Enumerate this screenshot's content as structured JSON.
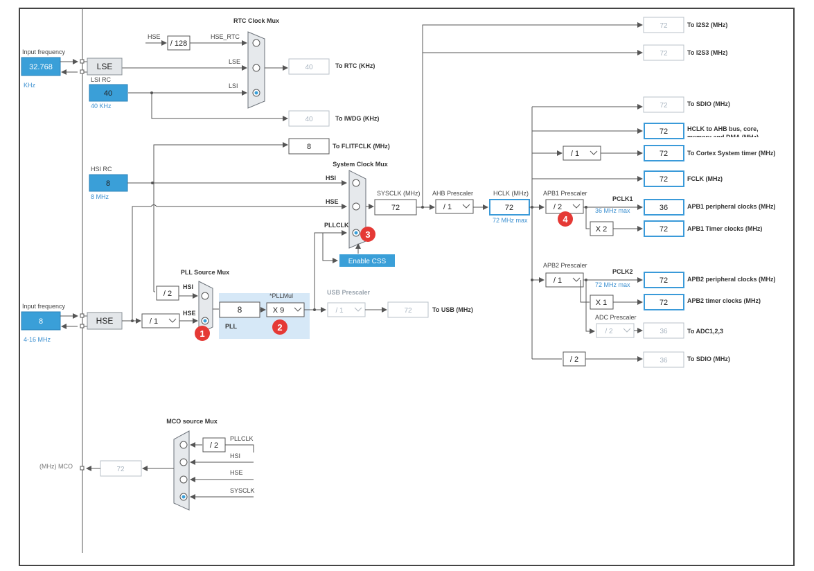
{
  "rtc_mux": {
    "title": "RTC Clock Mux",
    "hse": "HSE",
    "div": "/ 128",
    "hse_rtc": "HSE_RTC",
    "lse": "LSE",
    "lsi": "LSI",
    "out": "40",
    "out_label": "To RTC (KHz)"
  },
  "iwdg": {
    "out": "40",
    "label": "To IWDG (KHz)"
  },
  "flit": {
    "out": "8",
    "label": "To FLITFCLK (MHz)"
  },
  "lse": {
    "input_label": "Input frequency",
    "input": "32.768",
    "unit": "KHz",
    "name": "LSE"
  },
  "lsi": {
    "title": "LSI RC",
    "value": "40",
    "unit": "40 KHz"
  },
  "hsi": {
    "title": "HSI RC",
    "value": "8",
    "unit": "8 MHz"
  },
  "hse": {
    "input_label": "Input frequency",
    "input": "8",
    "unit": "4-16 MHz",
    "name": "HSE",
    "div": "/ 1"
  },
  "pll_source": {
    "title": "PLL Source Mux",
    "div": "/ 2",
    "hsi": "HSI",
    "hse": "HSE"
  },
  "pll": {
    "value": "8",
    "mul_title": "*PLLMul",
    "mul": "X 9",
    "label": "PLL"
  },
  "usb": {
    "title": "USB Prescaler",
    "div": "/ 1",
    "out": "72",
    "label": "To USB (MHz)"
  },
  "sys_mux": {
    "title": "System Clock Mux",
    "hsi": "HSI",
    "hse": "HSE",
    "pllclk": "PLLCLK",
    "css": "Enable CSS"
  },
  "sysclk": {
    "title": "SYSCLK (MHz)",
    "value": "72"
  },
  "ahb": {
    "title": "AHB Prescaler",
    "div": "/ 1"
  },
  "hclk": {
    "title": "HCLK (MHz)",
    "value": "72",
    "max": "72 MHz max"
  },
  "apb1": {
    "title": "APB1 Prescaler",
    "div": "/ 2",
    "pclk": "PCLK1",
    "max": "36 MHz max",
    "timer_mul": "X 2"
  },
  "apb2": {
    "title": "APB2 Prescaler",
    "div": "/ 1",
    "pclk": "PCLK2",
    "max": "72 MHz max",
    "timer_mul": "X 1"
  },
  "adc": {
    "title": "ADC Prescaler",
    "div": "/ 2",
    "out": "36",
    "label": "To ADC1,2,3"
  },
  "cortex": {
    "div": "/ 1"
  },
  "sdio2": {
    "div": "/ 2",
    "out": "36",
    "label": "To SDIO (MHz)"
  },
  "outputs": {
    "i2s2": {
      "value": "72",
      "label": "To I2S2 (MHz)"
    },
    "i2s3": {
      "value": "72",
      "label": "To I2S3 (MHz)"
    },
    "sdio": {
      "value": "72",
      "label": "To SDIO (MHz)"
    },
    "hclk_ahb": {
      "value": "72",
      "label": "HCLK to AHB bus, core,",
      "label2": "memory and DMA (MHz)"
    },
    "cortex": {
      "value": "72",
      "label": "To Cortex System timer (MHz)"
    },
    "fclk": {
      "value": "72",
      "label": "FCLK (MHz)"
    },
    "apb1_periph": {
      "value": "36",
      "label": "APB1 peripheral clocks (MHz)"
    },
    "apb1_timer": {
      "value": "72",
      "label": "APB1 Timer clocks (MHz)"
    },
    "apb2_periph": {
      "value": "72",
      "label": "APB2 peripheral clocks (MHz)"
    },
    "apb2_timer": {
      "value": "72",
      "label": "APB2 timer clocks (MHz)"
    }
  },
  "mco": {
    "title": "MCO source Mux",
    "div": "/ 2",
    "pllclk": "PLLCLK",
    "hsi": "HSI",
    "hse": "HSE",
    "sysclk": "SYSCLK",
    "out": "72",
    "label": "(MHz) MCO"
  },
  "badges": [
    "1",
    "2",
    "3",
    "4"
  ]
}
